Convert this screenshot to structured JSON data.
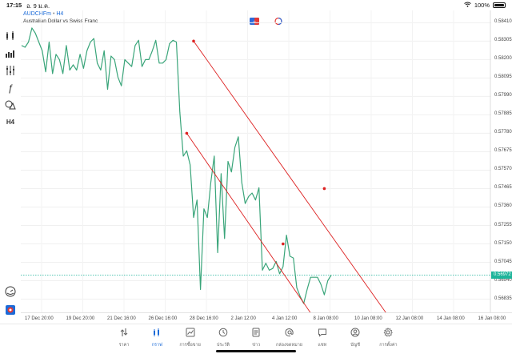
{
  "status": {
    "time": "17:15",
    "date": "อ. 9 ม.ค.",
    "battery": "100%"
  },
  "symbol": {
    "name": "AUDCHFm",
    "separator": "•",
    "timeframe": "H4",
    "description": "Australian Dollar vs Swiss Franc"
  },
  "toolbar": [
    {
      "name": "crosshair-tool-icon"
    },
    {
      "name": "chart-type-icon"
    },
    {
      "name": "indicators-icon"
    },
    {
      "name": "function-icon",
      "glyph": "ƒ"
    },
    {
      "name": "objects-icon"
    },
    {
      "name": "timeframe-label",
      "text": "H4"
    }
  ],
  "bottom_tools": [
    {
      "name": "gauge-icon"
    },
    {
      "name": "broker-icon"
    }
  ],
  "price_axis": {
    "labels": [
      "0.58410",
      "0.58305",
      "0.58200",
      "0.58095",
      "0.57990",
      "0.57885",
      "0.57780",
      "0.57675",
      "0.57570",
      "0.57465",
      "0.57360",
      "0.57255",
      "0.57150",
      "0.57045",
      "0.56940",
      "0.56835"
    ],
    "current": "0.56972"
  },
  "time_axis": {
    "labels": [
      "17 Dec 20:00",
      "19 Dec 20:00",
      "21 Dec 16:00",
      "26 Dec 16:00",
      "28 Dec 16:00",
      "2 Jan 12:00",
      "4 Jan 12:00",
      "8 Jan 08:00",
      "10 Jan 08:00",
      "12 Jan 08:00",
      "14 Jan 08:00",
      "16 Jan 08:00"
    ]
  },
  "chart_data": {
    "type": "line",
    "series": [
      {
        "color": "#3aa57a",
        "y": [
          0.5828,
          0.5827,
          0.583,
          0.5838,
          0.5835,
          0.583,
          0.5825,
          0.5813,
          0.583,
          0.5812,
          0.5823,
          0.582,
          0.5812,
          0.5828,
          0.5814,
          0.5817,
          0.5814,
          0.5823,
          0.5815,
          0.5825,
          0.583,
          0.5832,
          0.5818,
          0.5814,
          0.5825,
          0.5803,
          0.5822,
          0.582,
          0.581,
          0.5805,
          0.582,
          0.5818,
          0.5816,
          0.5828,
          0.5831,
          0.5816,
          0.582,
          0.582,
          0.5825,
          0.5831,
          0.5818,
          0.5818,
          0.582,
          0.5829,
          0.5831,
          0.583,
          0.579,
          0.5765,
          0.5768,
          0.576,
          0.573,
          0.574,
          0.5689,
          0.5735,
          0.573,
          0.575,
          0.5765,
          0.571,
          0.5755,
          0.5718,
          0.5762,
          0.5756,
          0.577,
          0.5776,
          0.575,
          0.5738,
          0.5742,
          0.5744,
          0.574,
          0.5747,
          0.57,
          0.5704,
          0.57,
          0.5701,
          0.5705,
          0.5698,
          0.5702,
          0.572,
          0.5708,
          0.5707,
          0.569,
          0.5685,
          0.5681,
          0.5689,
          0.5696,
          0.5696,
          0.5696,
          0.5692,
          0.5686,
          0.5694,
          0.56972
        ]
      }
    ],
    "trendlines": [
      {
        "color": "#dd2222",
        "from": {
          "index": 50,
          "y": 0.58305
        },
        "mid": {
          "index": 88,
          "y": 0.57465
        },
        "to": {
          "index": 108,
          "y": 0.567
        }
      },
      {
        "color": "#dd2222",
        "from": {
          "index": 48,
          "y": 0.5778
        },
        "mid": {
          "index": 76,
          "y": 0.5715
        },
        "to": {
          "index": 86,
          "y": 0.567
        }
      }
    ],
    "current_price": 0.56972,
    "ylim": [
      0.5676,
      0.5848
    ],
    "grid": true
  },
  "tabs": [
    {
      "label": "ราคา",
      "icon": "quotes-icon",
      "active": false
    },
    {
      "label": "กราฟ",
      "icon": "chart-icon",
      "active": true
    },
    {
      "label": "การซื้อขาย",
      "icon": "trade-icon",
      "active": false
    },
    {
      "label": "ประวัติ",
      "icon": "history-icon",
      "active": false
    },
    {
      "label": "ข่าว",
      "icon": "news-icon",
      "active": false
    },
    {
      "label": "กล่องจดหมาย",
      "icon": "mailbox-icon",
      "active": false
    },
    {
      "label": "แชท",
      "icon": "chat-icon",
      "active": false
    },
    {
      "label": "บัญชี",
      "icon": "account-icon",
      "active": false
    },
    {
      "label": "การตั้งค่า",
      "icon": "settings-icon",
      "active": false
    }
  ]
}
